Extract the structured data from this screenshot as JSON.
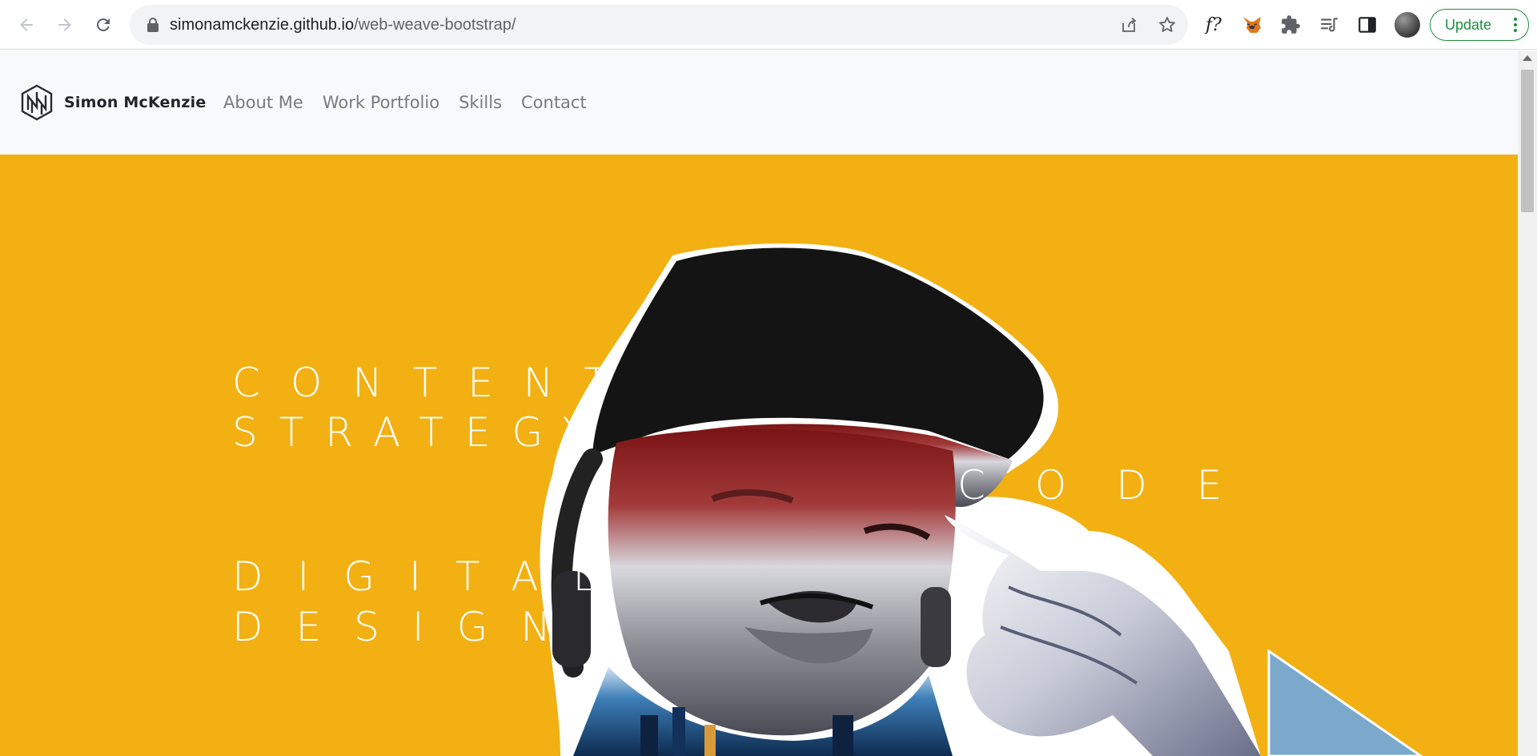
{
  "browser": {
    "url_host": "simonamckenzie.github.io",
    "url_path": "/web-weave-bootstrap/",
    "extension_fx_label": "f?",
    "update_label": "Update",
    "icons": [
      "back-arrow-icon",
      "forward-arrow-icon",
      "reload-icon",
      "lock-icon",
      "share-icon",
      "star-icon",
      "fox-extension-icon",
      "puzzle-extensions-icon",
      "media-queue-icon",
      "side-panel-icon",
      "profile-avatar",
      "more-vert-icon"
    ]
  },
  "site": {
    "brand_name": "Simon McKenzie",
    "nav": [
      {
        "label": "About Me"
      },
      {
        "label": "Work Portfolio"
      },
      {
        "label": "Skills"
      },
      {
        "label": "Contact"
      }
    ]
  },
  "hero": {
    "line1": "CONTENT",
    "line2": "STRATEGY",
    "line3": "DIGITAL",
    "line4": "DESIGN",
    "word_right": "CODE",
    "background_color": "#f2b012",
    "text_color": "#ffffff"
  }
}
